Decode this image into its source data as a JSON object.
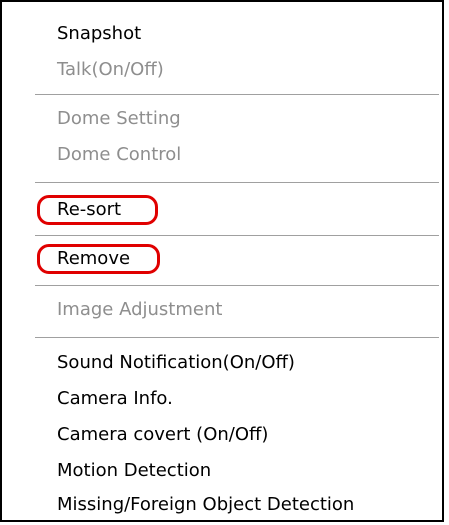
{
  "menu": {
    "items": [
      {
        "label": "Snapshot",
        "enabled": true
      },
      {
        "label": "Talk(On/Off)",
        "enabled": false
      },
      {
        "label": "Dome Setting",
        "enabled": false
      },
      {
        "label": "Dome Control",
        "enabled": false
      },
      {
        "label": "Re-sort",
        "enabled": true,
        "highlighted": true
      },
      {
        "label": "Remove",
        "enabled": true,
        "highlighted": true
      },
      {
        "label": "Image Adjustment",
        "enabled": false
      },
      {
        "label": "Sound Notification(On/Off)",
        "enabled": true
      },
      {
        "label": "Camera Info.",
        "enabled": true
      },
      {
        "label": "Camera covert (On/Off)",
        "enabled": true
      },
      {
        "label": "Motion Detection",
        "enabled": true
      },
      {
        "label": "Missing/Foreign Object Detection",
        "enabled": true
      }
    ]
  },
  "colors": {
    "highlight_outline": "#e00000",
    "disabled_text": "#8e8e8e",
    "separator": "#a0a0a0"
  }
}
